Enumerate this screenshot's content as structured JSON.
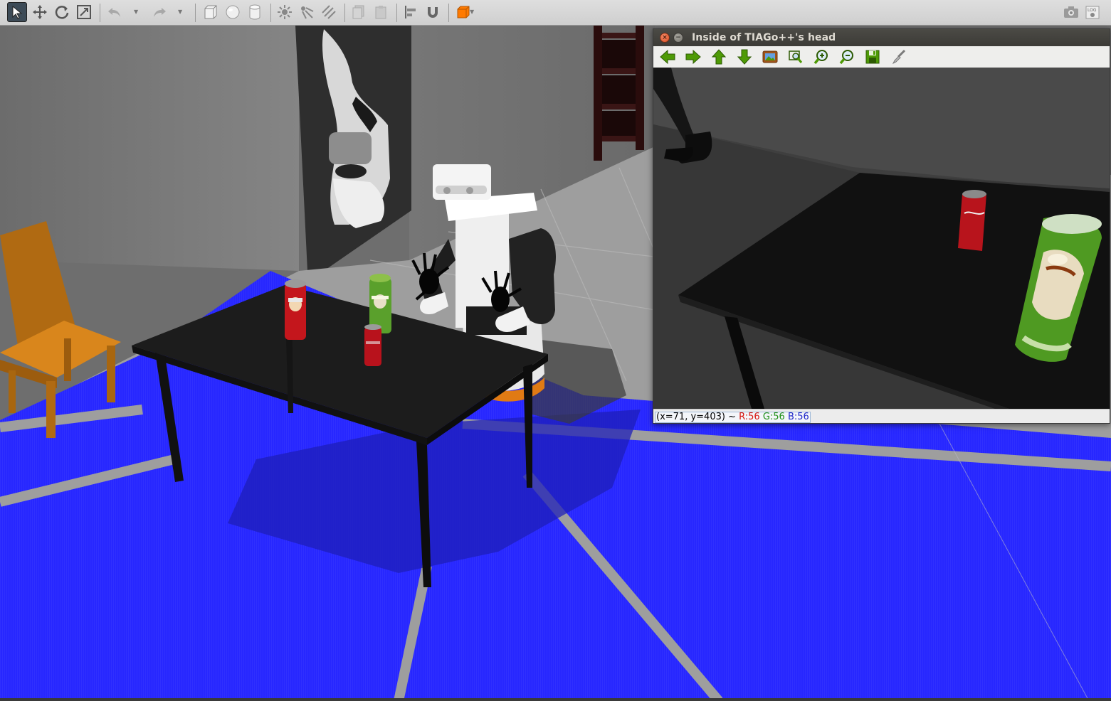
{
  "toolbar": {
    "left_tools": [
      {
        "name": "select-mode-icon",
        "active": true
      },
      {
        "name": "translate-mode-icon",
        "active": false
      },
      {
        "name": "rotate-mode-icon",
        "active": false
      },
      {
        "name": "scale-mode-icon",
        "active": false
      }
    ],
    "right_tools": [
      {
        "name": "screenshot-icon"
      },
      {
        "name": "log-icon"
      }
    ]
  },
  "image_view": {
    "title": "Inside of TIAGo++'s head",
    "toolbar_icons": [
      "arrow-left-icon",
      "arrow-right-icon",
      "arrow-up-icon",
      "arrow-down-icon",
      "view-image-icon",
      "zoom-fit-icon",
      "zoom-in-icon",
      "zoom-out-icon",
      "save-icon",
      "clear-brush-icon"
    ],
    "status": {
      "coords": "(x=71, y=403) ~",
      "r": "R:56",
      "g": "G:56",
      "b": "B:56"
    }
  },
  "colors": {
    "floor_blue": "#2b2bff",
    "wall_gray": "#7a7a7a",
    "table_black": "#1a1a1a",
    "chair_orange": "#c8781c",
    "toolbar_bg": "#d6d6d6",
    "icon_green": "#4e9a06",
    "close_red": "#e4592e"
  }
}
